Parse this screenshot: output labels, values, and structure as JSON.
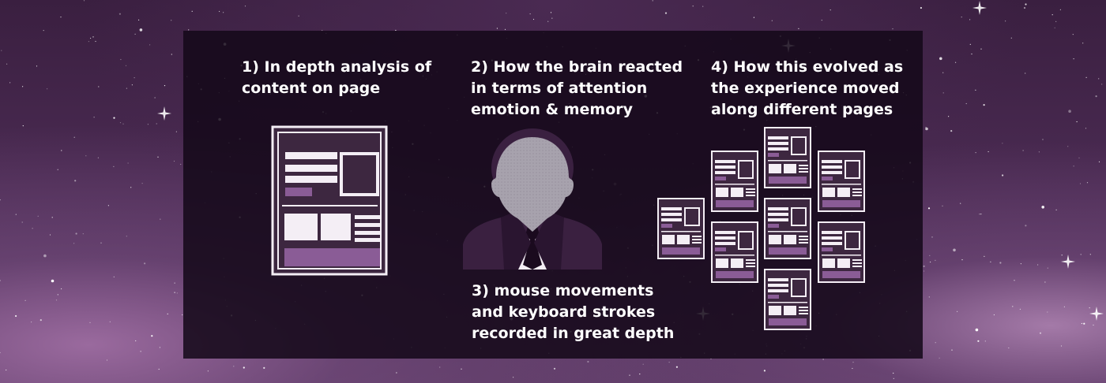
{
  "captions": {
    "step1": [
      "1) In depth analysis of",
      "content on page"
    ],
    "step2": [
      "2) How the brain reacted",
      "in terms of attention",
      "emotion & memory"
    ],
    "step3": [
      "3) mouse movements",
      "and keyboard strokes",
      "recorded in great depth"
    ],
    "step4": [
      "4) How this evolved as",
      "the experience moved",
      "along different pages"
    ]
  },
  "icons": {
    "document": "document-wireframe-icon",
    "person": "person-silhouette-icon",
    "page_network": "page-network-icon"
  },
  "colors": {
    "panel": "#1b0a1f",
    "accent": "#8a5c96",
    "page_fill": "#3d2740",
    "light": "#f4eef5",
    "text": "#ffffff"
  }
}
